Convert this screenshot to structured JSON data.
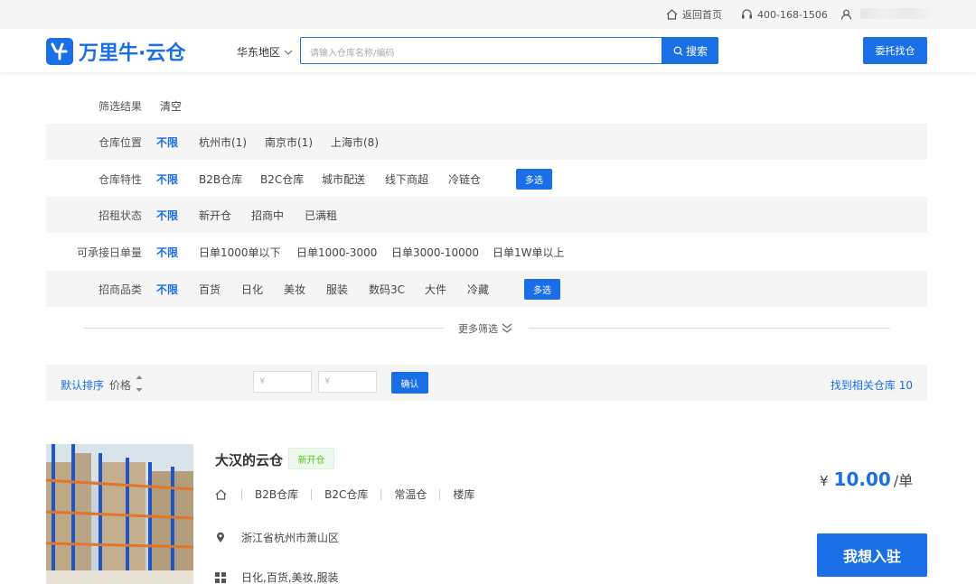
{
  "topbar": {
    "home_label": "返回首页",
    "phone": "400-168-1506"
  },
  "header": {
    "logo_text": "万里牛·云仓",
    "region": "华东地区",
    "search_placeholder": "请输入仓库名称/编码",
    "search_button": "搜索",
    "entrust_button": "委托找仓"
  },
  "filters": {
    "result_label": "筛选结果",
    "clear_label": "清空",
    "rows": [
      {
        "label": "仓库位置",
        "options": [
          "不限",
          "杭州市(1)",
          "南京市(1)",
          "上海市(8)"
        ],
        "multi": ""
      },
      {
        "label": "仓库特性",
        "options": [
          "不限",
          "B2B仓库",
          "B2C仓库",
          "城市配送",
          "线下商超",
          "冷链仓"
        ],
        "multi": "多选"
      },
      {
        "label": "招租状态",
        "options": [
          "不限",
          "新开仓",
          "招商中",
          "已满租"
        ],
        "multi": ""
      },
      {
        "label": "可承接日单量",
        "options": [
          "不限",
          "日单1000单以下",
          "日单1000-3000",
          "日单3000-10000",
          "日单1W单以上"
        ],
        "multi": ""
      },
      {
        "label": "招商品类",
        "options": [
          "不限",
          "百货",
          "日化",
          "美妆",
          "服装",
          "数码3C",
          "大件",
          "冷藏"
        ],
        "multi": "多选"
      }
    ],
    "more_label": "更多筛选"
  },
  "sortbar": {
    "default_label": "默认排序",
    "price_label": "价格",
    "min_placeholder": "¥",
    "max_placeholder": "¥",
    "confirm_label": "确认",
    "found_label": "找到相关仓库 10"
  },
  "warehouse": {
    "name": "大汉的云仓",
    "badge": "新开仓",
    "tags": [
      "B2B仓库",
      "B2C仓库",
      "常温仓",
      "楼库"
    ],
    "location": "浙江省杭州市萧山区",
    "categories": "日化,百货,美妆,服装",
    "price_symbol": "¥",
    "price": "10.00",
    "price_unit": "/单",
    "join_button": "我想入驻"
  },
  "colors": {
    "accent": "#1a6fe6",
    "badge_green": "#52c41a",
    "row_shade": "#f5f5f5"
  }
}
